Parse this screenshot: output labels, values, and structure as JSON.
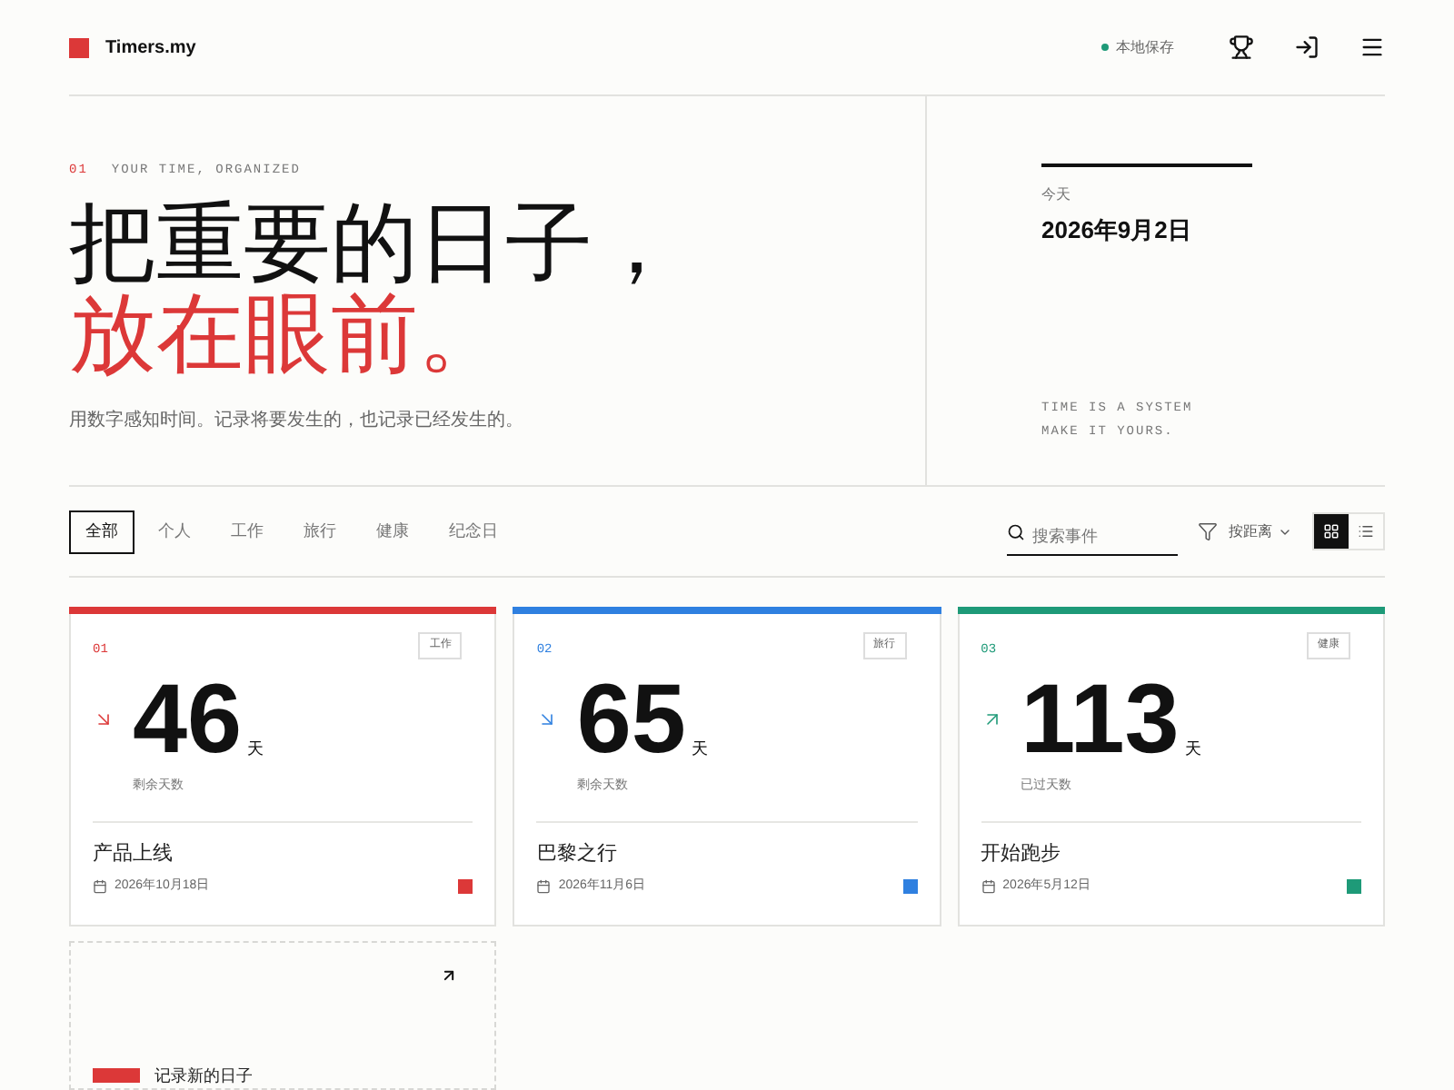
{
  "header": {
    "brand": "Timers.my",
    "save_status": "本地保存"
  },
  "hero": {
    "index": "01",
    "eyebrow": "YOUR TIME, ORGANIZED",
    "title_line_1": "把重要的日子，",
    "title_line_2": "放在眼前。",
    "subtitle": "用数字感知时间。记录将要发生的，也记录已经发生的。",
    "today_label": "今天",
    "today_date": "2026年9月2日",
    "motto_line_1": "TIME IS A SYSTEM",
    "motto_line_2": "MAKE IT YOURS."
  },
  "filters": {
    "tabs": [
      {
        "label": "全部",
        "selected": true
      },
      {
        "label": "个人",
        "selected": false
      },
      {
        "label": "工作",
        "selected": false
      },
      {
        "label": "旅行",
        "selected": false
      },
      {
        "label": "健康",
        "selected": false
      },
      {
        "label": "纪念日",
        "selected": false
      }
    ],
    "search": {
      "placeholder": "搜索事件"
    },
    "sort": "按距离",
    "views": [
      {
        "kind": "grid",
        "selected": true
      },
      {
        "kind": "list",
        "selected": false
      }
    ]
  },
  "cards": [
    {
      "index": "01",
      "tag": "工作",
      "kind": "countdown",
      "number": "46",
      "unit": "天",
      "caption": "剩余天数",
      "title": "产品上线",
      "date": "2026年10月18日",
      "color": "#dc3838"
    },
    {
      "index": "02",
      "tag": "旅行",
      "kind": "countdown",
      "number": "65",
      "unit": "天",
      "caption": "剩余天数",
      "title": "巴黎之行",
      "date": "2026年11月6日",
      "color": "#2f80e0"
    },
    {
      "index": "03",
      "tag": "健康",
      "kind": "countup",
      "number": "113",
      "unit": "天",
      "caption": "已过天数",
      "title": "开始跑步",
      "date": "2026年5月12日",
      "color": "#1e9a78"
    }
  ],
  "new_card": {
    "label": "记录新的日子"
  }
}
